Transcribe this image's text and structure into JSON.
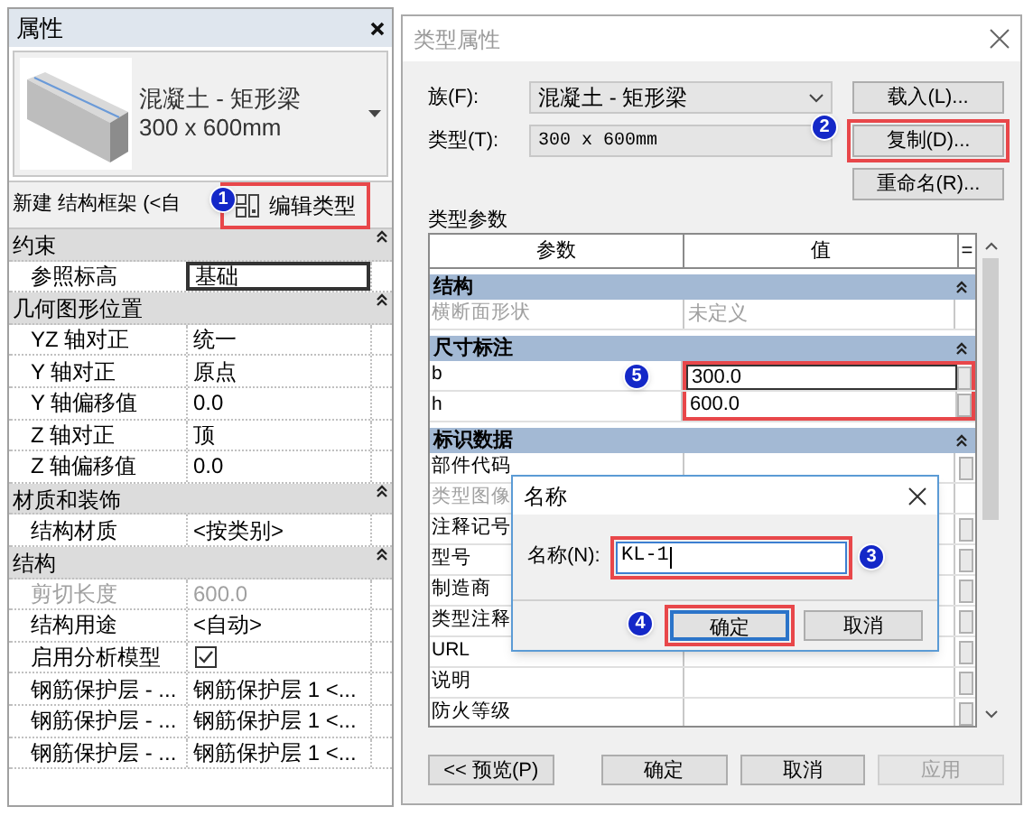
{
  "properties_panel": {
    "title": "属性",
    "type_name": "混凝土 - 矩形梁",
    "type_size": "300 x 600mm",
    "instance_label": "新建 结构框架 (<自",
    "edit_type_button": {
      "label": "编辑类型",
      "highlighted": true
    },
    "rows": [
      {
        "kind": "group",
        "label": "约束"
      },
      {
        "kind": "field",
        "label": "参照标高",
        "value": "基础",
        "disabled": false,
        "editing": true
      },
      {
        "kind": "group",
        "label": "几何图形位置"
      },
      {
        "kind": "field",
        "label": "YZ 轴对正",
        "value": "统一",
        "disabled": false,
        "editing": false
      },
      {
        "kind": "field",
        "label": "Y 轴对正",
        "value": "原点",
        "disabled": false,
        "editing": false
      },
      {
        "kind": "field",
        "label": "Y 轴偏移值",
        "value": "0.0",
        "disabled": false,
        "editing": false
      },
      {
        "kind": "field",
        "label": "Z 轴对正",
        "value": "顶",
        "disabled": false,
        "editing": false
      },
      {
        "kind": "field",
        "label": "Z 轴偏移值",
        "value": "0.0",
        "disabled": false,
        "editing": false
      },
      {
        "kind": "group",
        "label": "材质和装饰"
      },
      {
        "kind": "field",
        "label": "结构材质",
        "value": "<按类别>",
        "disabled": false,
        "editing": false
      },
      {
        "kind": "group",
        "label": "结构"
      },
      {
        "kind": "field",
        "label": "剪切长度",
        "value": "600.0",
        "disabled": true,
        "editing": false
      },
      {
        "kind": "field",
        "label": "结构用途",
        "value": "<自动>",
        "disabled": false,
        "editing": false
      },
      {
        "kind": "checkbox",
        "label": "启用分析模型",
        "checked": true,
        "disabled": false
      },
      {
        "kind": "field",
        "label": "钢筋保护层 - ...",
        "value": "钢筋保护层 1 <...",
        "disabled": false,
        "editing": false
      },
      {
        "kind": "field",
        "label": "钢筋保护层 - ...",
        "value": "钢筋保护层 1 <...",
        "disabled": false,
        "editing": false
      },
      {
        "kind": "field",
        "label": "钢筋保护层 - ...",
        "value": "钢筋保护层 1 <...",
        "disabled": false,
        "editing": false
      }
    ]
  },
  "type_dialog": {
    "title": "类型属性",
    "family_label": "族(F):",
    "family_value": "混凝土 - 矩形梁",
    "type_label": "类型(T):",
    "type_value": "300 x 600mm",
    "buttons": [
      {
        "label": "载入(L)...",
        "highlighted": false
      },
      {
        "label": "复制(D)...",
        "highlighted": true
      },
      {
        "label": "重命名(R)...",
        "highlighted": false
      }
    ],
    "params_label": "类型参数",
    "columns": [
      "参数",
      "值",
      "="
    ],
    "rows": [
      {
        "kind": "group",
        "label": "结构"
      },
      {
        "kind": "param",
        "label": "横断面形状",
        "value": "未定义",
        "disabled": true,
        "editing": false,
        "highlighted": false
      },
      {
        "kind": "group",
        "label": "尺寸标注"
      },
      {
        "kind": "param",
        "label": "b",
        "value": "300.0",
        "disabled": false,
        "editing": true,
        "highlighted": true
      },
      {
        "kind": "param",
        "label": "h",
        "value": "600.0",
        "disabled": false,
        "editing": false,
        "highlighted": true
      },
      {
        "kind": "group",
        "label": "标识数据"
      },
      {
        "kind": "param",
        "label": "部件代码",
        "disabled": false,
        "editing": false,
        "highlighted": false
      },
      {
        "kind": "param",
        "label": "类型图像",
        "disabled": true,
        "editing": false,
        "highlighted": false
      },
      {
        "kind": "param",
        "label": "注释记号",
        "disabled": false,
        "editing": false,
        "highlighted": false
      },
      {
        "kind": "param",
        "label": "型号",
        "disabled": false,
        "editing": false,
        "highlighted": false
      },
      {
        "kind": "param",
        "label": "制造商",
        "disabled": false,
        "editing": false,
        "highlighted": false
      },
      {
        "kind": "param",
        "label": "类型注释",
        "disabled": false,
        "editing": false,
        "highlighted": false
      },
      {
        "kind": "param",
        "label": "URL",
        "disabled": false,
        "editing": false,
        "highlighted": false
      },
      {
        "kind": "param",
        "label": "说明",
        "disabled": false,
        "editing": false,
        "highlighted": false
      },
      {
        "kind": "param",
        "label": "防火等级",
        "disabled": false,
        "editing": false,
        "highlighted": false
      }
    ],
    "footer_buttons": [
      {
        "label": "<< 预览(P)",
        "disabled": false
      },
      {
        "label": "确定",
        "disabled": false
      },
      {
        "label": "取消",
        "disabled": false
      },
      {
        "label": "应用",
        "disabled": true
      }
    ]
  },
  "name_dialog": {
    "title": "名称",
    "field_label": "名称(N):",
    "value": "KL-1",
    "field_highlighted": true,
    "buttons": [
      {
        "label": "确定",
        "default": true,
        "highlighted": true
      },
      {
        "label": "取消",
        "default": false,
        "highlighted": false
      }
    ]
  },
  "callouts": [
    {
      "number": "1"
    },
    {
      "number": "2"
    },
    {
      "number": "5"
    },
    {
      "number": "3"
    },
    {
      "number": "4"
    }
  ]
}
